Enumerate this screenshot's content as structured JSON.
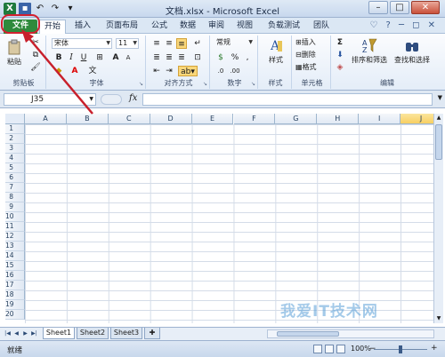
{
  "window": {
    "title": "文档.xlsx - Microsoft Excel",
    "qat": {
      "app_icon": "X",
      "save_icon": "save-icon",
      "undo_icon": "↶",
      "redo_icon": "↷",
      "more_icon": "▾"
    },
    "buttons": {
      "minimize": "–",
      "maximize": "□",
      "close": "✕"
    }
  },
  "tabs": [
    {
      "label": "文件"
    },
    {
      "label": "开始"
    },
    {
      "label": "插入"
    },
    {
      "label": "页面布局"
    },
    {
      "label": "公式"
    },
    {
      "label": "数据"
    },
    {
      "label": "审阅"
    },
    {
      "label": "视图"
    },
    {
      "label": "负载测试"
    },
    {
      "label": "团队"
    }
  ],
  "tabrow_icons": "♡ ? ─ ◻ ✕",
  "ribbon": {
    "clipboard": {
      "label": "剪贴板",
      "paste": "粘贴"
    },
    "font": {
      "label": "字体",
      "name": "宋体",
      "size": "11"
    },
    "alignment": {
      "label": "对齐方式"
    },
    "number": {
      "label": "数字",
      "format": "常规"
    },
    "styles": {
      "label": "样式",
      "button": "样式"
    },
    "cells": {
      "label": "单元格",
      "insert": "插入",
      "delete": "删除",
      "format": "格式"
    },
    "editing": {
      "label": "编辑",
      "sort": "排序和筛选",
      "find": "查找和选择"
    }
  },
  "formula_bar": {
    "name_box": "J35",
    "fx": "fx",
    "value": ""
  },
  "grid": {
    "columns": [
      "A",
      "B",
      "C",
      "D",
      "E",
      "F",
      "G",
      "H",
      "I",
      "J"
    ],
    "selected_column": "J",
    "rows": [
      "1",
      "2",
      "3",
      "4",
      "5",
      "6",
      "7",
      "8",
      "9",
      "10",
      "11",
      "12",
      "13",
      "14",
      "15",
      "16",
      "17",
      "18",
      "19",
      "20"
    ]
  },
  "sheets": [
    {
      "label": "Sheet1",
      "active": true
    },
    {
      "label": "Sheet2",
      "active": false
    },
    {
      "label": "Sheet3",
      "active": false
    }
  ],
  "status": {
    "text": "就绪",
    "zoom": "100%"
  },
  "watermark": "我爱IT技术网",
  "accent": {
    "file_tab": "#2e8a3c",
    "highlight": "#d22030"
  }
}
